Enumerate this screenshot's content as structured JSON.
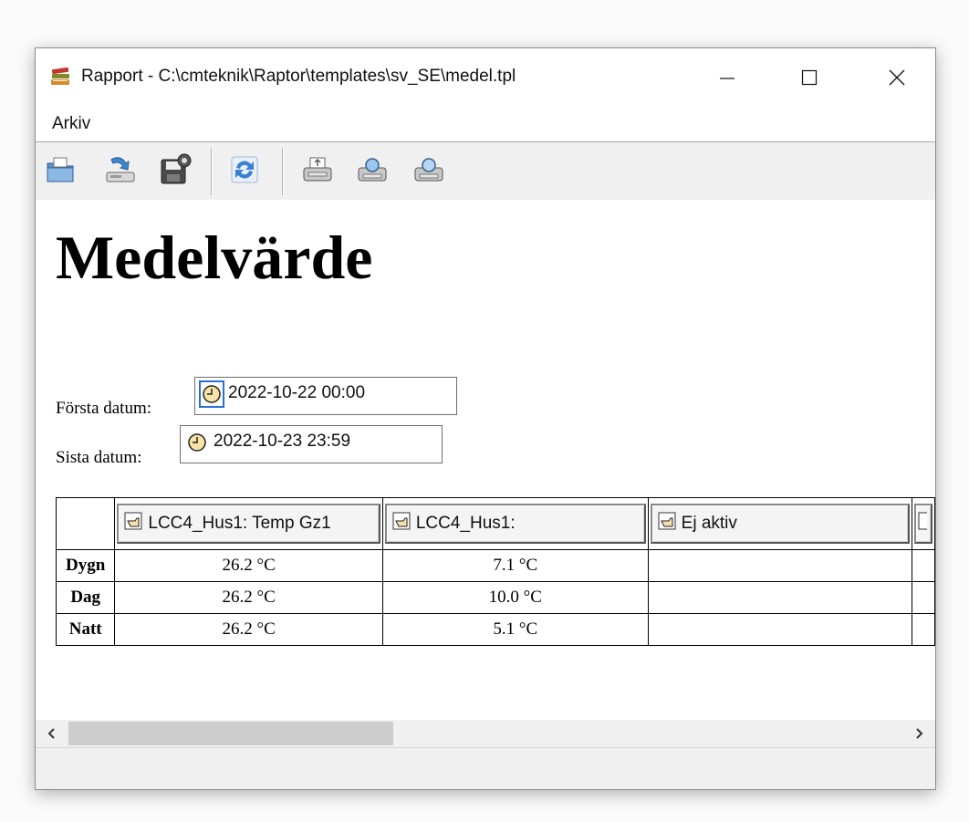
{
  "window": {
    "title": "Rapport - C:\\cmteknik\\Raptor\\templates\\sv_SE\\medel.tpl"
  },
  "menu": {
    "items": [
      {
        "label": "Arkiv"
      }
    ]
  },
  "toolbar": {
    "buttons": [
      {
        "icon": "open-folder-icon"
      },
      {
        "icon": "import-icon"
      },
      {
        "icon": "save-settings-icon"
      },
      {
        "icon": "refresh-icon"
      },
      {
        "icon": "print-icon"
      },
      {
        "icon": "print-preview-icon"
      },
      {
        "icon": "print-setup-icon"
      }
    ]
  },
  "report": {
    "heading": "Medelvärde",
    "first_date": {
      "label": "Första datum:",
      "value": "2022-10-22 00:00"
    },
    "last_date": {
      "label": "Sista datum:",
      "value": "2022-10-23 23:59"
    },
    "columns": [
      {
        "label": "LCC4_Hus1: Temp Gz1"
      },
      {
        "label": "LCC4_Hus1:"
      },
      {
        "label": "Ej aktiv"
      }
    ],
    "rows": [
      {
        "label": "Dygn",
        "values": [
          "26.2 °C",
          "7.1 °C",
          ""
        ]
      },
      {
        "label": "Dag",
        "values": [
          "26.2 °C",
          "10.0 °C",
          ""
        ]
      },
      {
        "label": "Natt",
        "values": [
          "26.2 °C",
          "5.1 °C",
          ""
        ]
      }
    ]
  },
  "colors": {
    "window_bg": "#ffffff",
    "toolbar_bg": "#f0f0f0",
    "selection_border": "#2a6fd6"
  }
}
